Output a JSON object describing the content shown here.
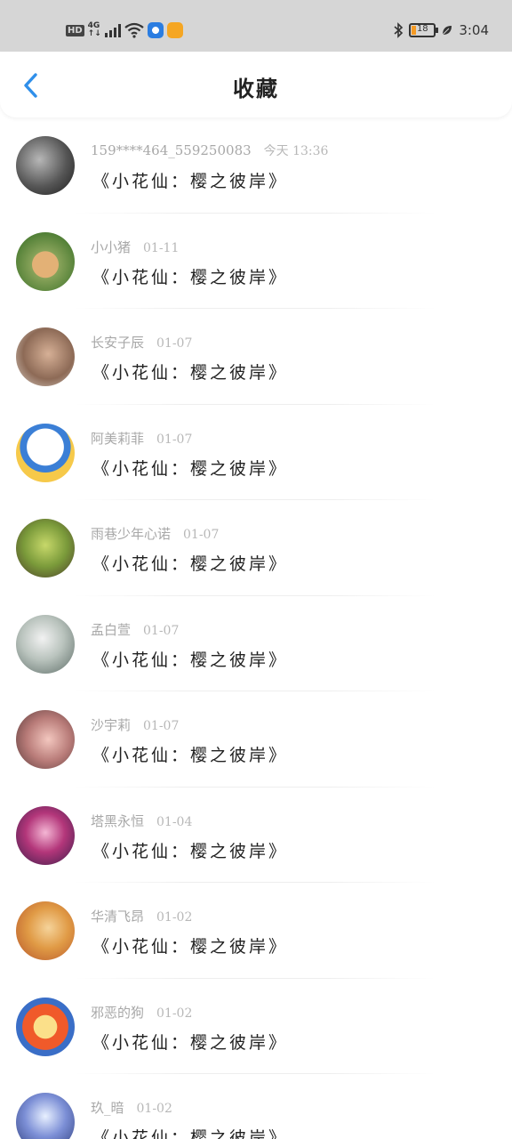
{
  "status_bar": {
    "hd": "HD",
    "network": "4G",
    "battery": "18",
    "battery_fraction": 0.18,
    "time": "3:04"
  },
  "header": {
    "title": "收藏",
    "back_icon": "chevron-left-icon"
  },
  "colors": {
    "accent": "#2f8fea",
    "status_bar_bg": "#d6d6d6"
  },
  "list": [
    {
      "user": "159****464_559250083",
      "time": "今天 13:36",
      "content": "《小花仙：樱之彼岸》",
      "avatar_bg": "radial-gradient(circle at 40% 40%, #b7b7b7, #555 55%, #1c1c1c)"
    },
    {
      "user": "小小猪",
      "time": "01-11",
      "content": "《小花仙：樱之彼岸》",
      "avatar_bg": "radial-gradient(circle at 50% 55%, #e3b176 0 30%, #88a35a 31%, #4e7d34 75%)"
    },
    {
      "user": "长安子辰",
      "time": "01-07",
      "content": "《小花仙：樱之彼岸》",
      "avatar_bg": "radial-gradient(circle at 55% 45%, #d6b096, #8d6a56 55%, #d9cfc6)"
    },
    {
      "user": "阿美莉菲",
      "time": "01-07",
      "content": "《小花仙：樱之彼岸》",
      "avatar_bg": "radial-gradient(circle at 50% 40%, #ffffff 0 40%, #3b7fd6 41% 55%, #f6c94a 56%)"
    },
    {
      "user": "雨巷少年心诺",
      "time": "01-07",
      "content": "《小花仙：樱之彼岸》",
      "avatar_bg": "radial-gradient(circle at 50% 45%, #c7d86a, #7a9a3a 50%, #4b3b2a)"
    },
    {
      "user": "孟白萱",
      "time": "01-07",
      "content": "《小花仙：樱之彼岸》",
      "avatar_bg": "radial-gradient(circle at 45% 40%, #f2f2f2, #b9c3bd 45%, #5c6b66)"
    },
    {
      "user": "沙宇莉",
      "time": "01-07",
      "content": "《小花仙：樱之彼岸》",
      "avatar_bg": "radial-gradient(circle at 55% 50%, #f3c7bf, #b87b78 50%, #5a3b3b)"
    },
    {
      "user": "塔黑永恒",
      "time": "01-04",
      "content": "《小花仙：樱之彼岸》",
      "avatar_bg": "radial-gradient(circle at 50% 45%, #f4b6d4, #b3367a 45%, #3a1d4a)"
    },
    {
      "user": "华清飞昂",
      "time": "01-02",
      "content": "《小花仙：樱之彼岸》",
      "avatar_bg": "radial-gradient(circle at 55% 45%, #f5d39a, #e09a45 45%, #b5542a)"
    },
    {
      "user": "邪恶的狗",
      "time": "01-02",
      "content": "《小花仙：樱之彼岸》",
      "avatar_bg": "radial-gradient(circle at 50% 50%, #fbe08a 0 28%, #f05a2a 29% 55%, #3a6ec7 56%)"
    },
    {
      "user": "玖_暗",
      "time": "01-02",
      "content": "《小花仙：樱之彼岸》",
      "avatar_bg": "radial-gradient(circle at 50% 40%, #e8f0ff, #7c8fd6 45%, #2c3c7a)"
    }
  ]
}
